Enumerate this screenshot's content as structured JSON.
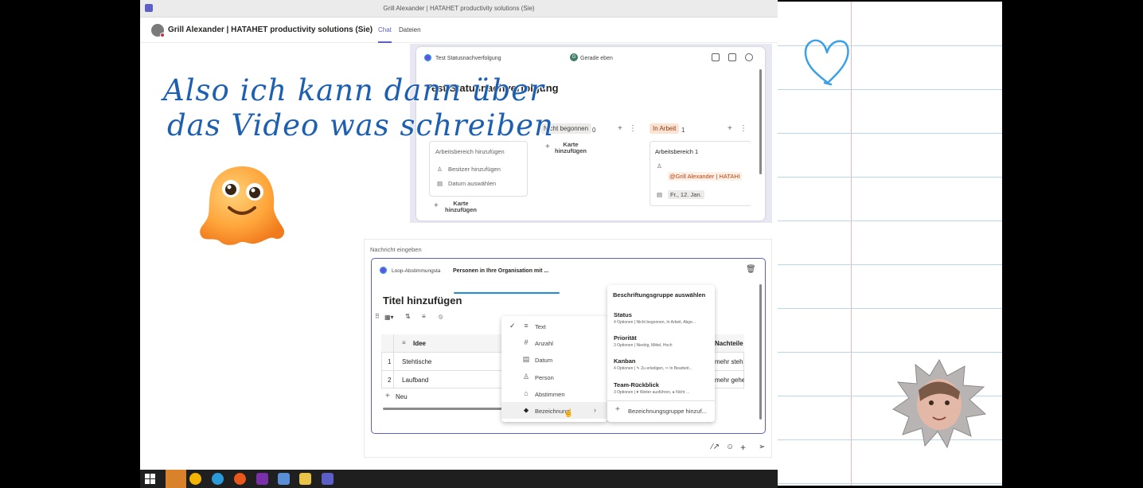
{
  "window": {
    "title": "Grill Alexander | HATAHET productivity solutions (Sie)"
  },
  "chat_header": {
    "name": "Grill Alexander | HATAHET productivity solutions (Sie)",
    "tabs": [
      "Chat",
      "Dateien"
    ],
    "active_tab": "Chat"
  },
  "loop_card": {
    "name": "Test Statusnachverfolgung",
    "status_initial": "G",
    "status_text": "Gerade eben",
    "title": "Test Statusnachverfolgung",
    "columns": [
      {
        "label": "Nicht begonnen",
        "count": "0"
      },
      {
        "label": "In Arbeit",
        "count": "1"
      }
    ],
    "left_card": {
      "title": "Arbeitsbereich hinzufügen",
      "owner": "Besitzer hinzufügen",
      "date": "Datum auswählen"
    },
    "add_card_label_1": "Karte",
    "add_card_label_2": "hinzufügen",
    "right_card": {
      "title": "Arbeitsbereich 1",
      "mention": "@Grill Alexander | HATAHI",
      "date": "Fr., 12. Jan."
    }
  },
  "compose": {
    "placeholder": "Nachricht eingeben",
    "component_name": "Loop-Abstimmungsta",
    "share_text": "Personen in Ihre Organisation mit ...",
    "editor_title": "Titel hinzufügen",
    "table": {
      "headers": [
        "Idee",
        "Nachteile"
      ],
      "rows": [
        {
          "num": "1",
          "idee": "Stehtische",
          "nachteile": "mehr steh"
        },
        {
          "num": "2",
          "idee": "Laufband",
          "nachteile": "mehr gehe"
        }
      ],
      "new_label": "Neu"
    }
  },
  "type_menu": {
    "items": [
      {
        "icon": "≡",
        "label": "Text",
        "checked": true
      },
      {
        "icon": "#",
        "label": "Anzahl"
      },
      {
        "icon": "▤",
        "label": "Datum"
      },
      {
        "icon": "♙",
        "label": "Person"
      },
      {
        "icon": "⌂",
        "label": "Abstimmen"
      },
      {
        "icon": "⬥",
        "label": "Bezeichnung",
        "selected": true
      }
    ]
  },
  "label_group_menu": {
    "header": "Beschriftungsgruppe auswählen",
    "groups": [
      {
        "title": "Status",
        "sub": "4 Optionen | Nicht begonnen, In Arbeit, Abge..."
      },
      {
        "title": "Priorität",
        "sub": "3 Optionen | Niedrig, Mittel, Hoch"
      },
      {
        "title": "Kanban",
        "sub": "4 Optionen | ✎ Zu erledigen, ✂ In Bearbeit..."
      },
      {
        "title": "Team-Rückblick",
        "sub": "3 Optionen | ♥ Weiter ausführen, ● Nicht ..."
      }
    ],
    "add_label": "Bezeichnungsgruppe hinzuf..."
  },
  "handwriting": {
    "line1": "Also ich kann dann über",
    "line2": "das Video was schreiben"
  },
  "colors": {
    "teams_purple": "#5b5fc7",
    "ink_blue": "#1d5fb0",
    "heart_blue": "#3aa0e8"
  }
}
